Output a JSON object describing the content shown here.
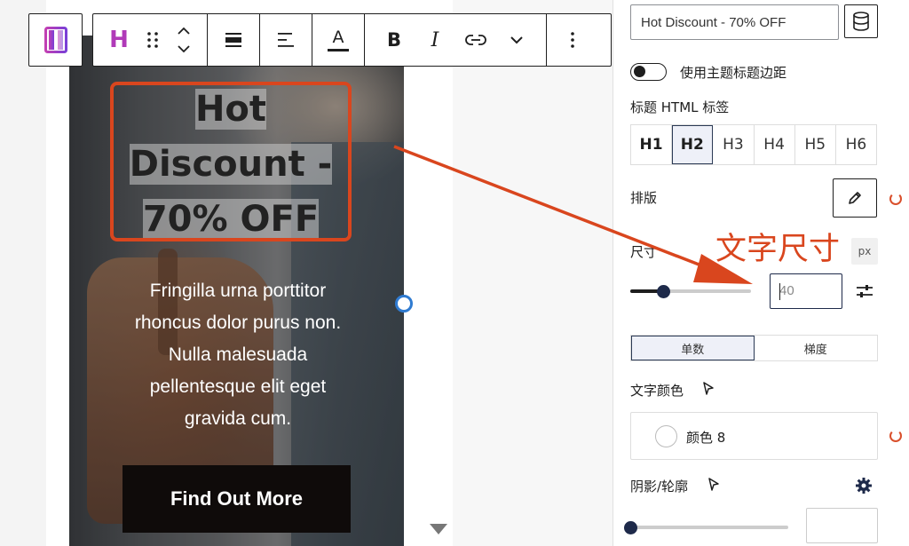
{
  "hero": {
    "title_lines": [
      "Hot",
      "Discount -",
      "70% OFF"
    ],
    "body_lines": [
      "Fringilla urna porttitor",
      "rhoncus dolor purus non.",
      "Nulla malesuada",
      "pellentesque elit eget",
      "gravida cum."
    ],
    "cta_label": "Find Out More"
  },
  "toolbar": {
    "block_icon": "columns-block-icon",
    "heading_letter": "H",
    "text_color_letter": "A",
    "bold_letter": "B",
    "italic_letter": "I"
  },
  "sidebar": {
    "heading_text": "Hot Discount - 70% OFF",
    "use_theme_margin_label": "使用主题标题边距",
    "use_theme_margin_on": false,
    "html_tag_label": "标题 HTML 标签",
    "heading_levels": [
      "H1",
      "H2",
      "H3",
      "H4",
      "H5",
      "H6"
    ],
    "active_level": "H2",
    "typography_label": "排版",
    "size_label": "尺寸",
    "size_unit": "px",
    "size_placeholder": "40",
    "size_slider_fraction": 0.27,
    "mode_options": [
      "单数",
      "梯度"
    ],
    "active_mode": "单数",
    "text_color_label": "文字颜色",
    "color_name": "颜色 8",
    "shadow_label": "阴影/轮廓",
    "shadow_slider_fraction": 0.0
  },
  "annotation": {
    "text": "文字尺寸",
    "color": "#d9461e"
  },
  "colors": {
    "accent": "#d9461e",
    "dark": "#1e1e1e",
    "selected_bg": "#eef0f8"
  }
}
